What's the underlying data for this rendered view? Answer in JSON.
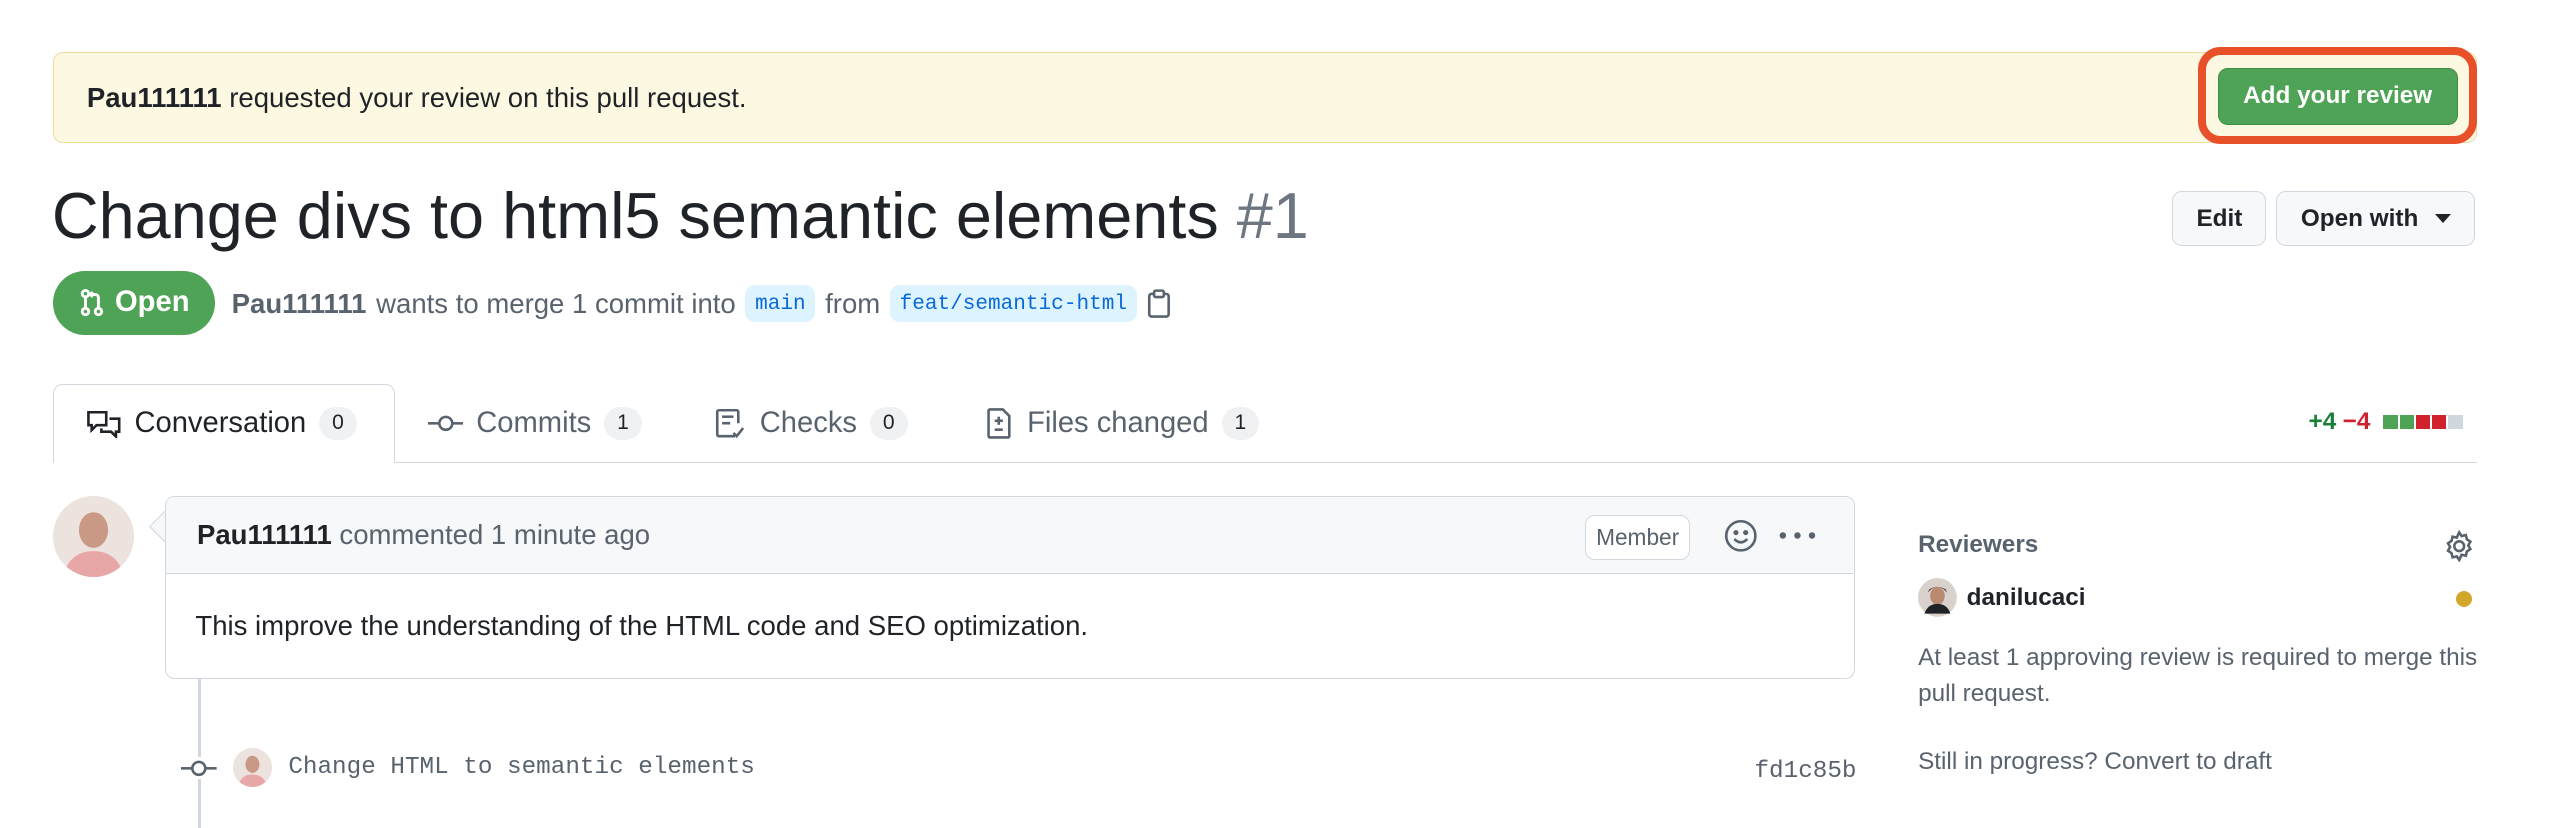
{
  "banner": {
    "requester": "Pau111111",
    "message": "requested your review on this pull request.",
    "action_label": "Add your review"
  },
  "header": {
    "title": "Change divs to html5 semantic elements",
    "number": "#1",
    "edit_label": "Edit",
    "open_with_label": "Open with"
  },
  "state": {
    "label": "Open",
    "author": "Pau111111",
    "text_merge": "wants to merge 1 commit into",
    "base_branch": "main",
    "text_from": "from",
    "head_branch": "feat/semantic-html"
  },
  "tabs": [
    {
      "label": "Conversation",
      "count": "0"
    },
    {
      "label": "Commits",
      "count": "1"
    },
    {
      "label": "Checks",
      "count": "0"
    },
    {
      "label": "Files changed",
      "count": "1"
    }
  ],
  "diffstat": {
    "additions": "+4",
    "deletions": "−4"
  },
  "comment": {
    "author": "Pau111111",
    "action": "commented",
    "time": "1 minute ago",
    "badge": "Member",
    "body": "This improve the understanding of the HTML code and SEO optimization."
  },
  "commit": {
    "message": "Change HTML to semantic elements",
    "sha": "fd1c85b"
  },
  "sidebar": {
    "reviewers_title": "Reviewers",
    "reviewer": "danilucaci",
    "requirement": "At least 1 approving review is required to merge this pull request.",
    "draft_note": "Still in progress? Convert to draft"
  },
  "colors": {
    "open_green": "#4fa356",
    "highlight_ring": "#e8502a",
    "pending_dot": "#d4a72c"
  }
}
